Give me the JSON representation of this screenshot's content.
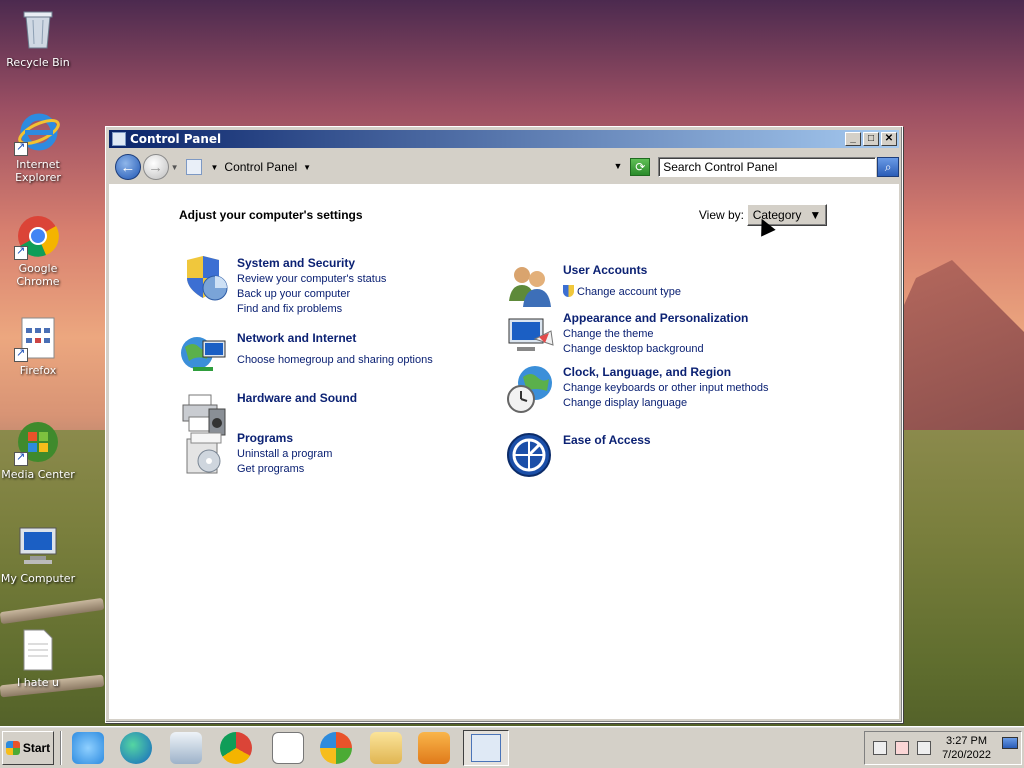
{
  "desktop": {
    "icons": [
      {
        "label": "Recycle Bin",
        "icon": "recycle-bin-icon"
      },
      {
        "label": "Internet\nExplorer",
        "icon": "internet-explorer-icon"
      },
      {
        "label": "Google Chrome",
        "icon": "chrome-icon"
      },
      {
        "label": "Firefox",
        "icon": "firefox-icon"
      },
      {
        "label": "Media Center",
        "icon": "media-center-icon"
      },
      {
        "label": "My Computer",
        "icon": "my-computer-icon"
      },
      {
        "label": "I hate u",
        "icon": "text-file-icon"
      }
    ]
  },
  "window": {
    "title": "Control Panel",
    "address": {
      "crumb": "Control Panel",
      "search_placeholder": "Search Control Panel"
    },
    "heading": "Adjust your computer's settings",
    "view_by": {
      "label": "View by:",
      "value": "Category"
    },
    "categories": [
      {
        "title": "System and Security",
        "links": [
          "Review your computer's status",
          "Back up your computer",
          "Find and fix problems"
        ]
      },
      {
        "title": "Network and Internet",
        "links": [
          "Choose homegroup and sharing options"
        ]
      },
      {
        "title": "Hardware and Sound",
        "links": []
      },
      {
        "title": "Programs",
        "links": [
          "Uninstall a program",
          "Get programs"
        ]
      },
      {
        "title": "User Accounts",
        "links": [
          "Change account type"
        ]
      },
      {
        "title": "Appearance and Personalization",
        "links": [
          "Change the theme",
          "Change desktop background"
        ]
      },
      {
        "title": "Clock, Language, and Region",
        "links": [
          "Change keyboards or other input methods",
          "Change display language"
        ]
      },
      {
        "title": "Ease of Access",
        "links": []
      }
    ]
  },
  "taskbar": {
    "start_label": "Start",
    "time": "3:27 PM",
    "date": "7/20/2022",
    "pinned": [
      "internet-explorer-icon",
      "edge-icon",
      "media-player-icon",
      "chrome-icon",
      "notepad-icon",
      "windows-logo-icon",
      "folder-icon",
      "video-player-icon",
      "control-panel-icon"
    ]
  }
}
